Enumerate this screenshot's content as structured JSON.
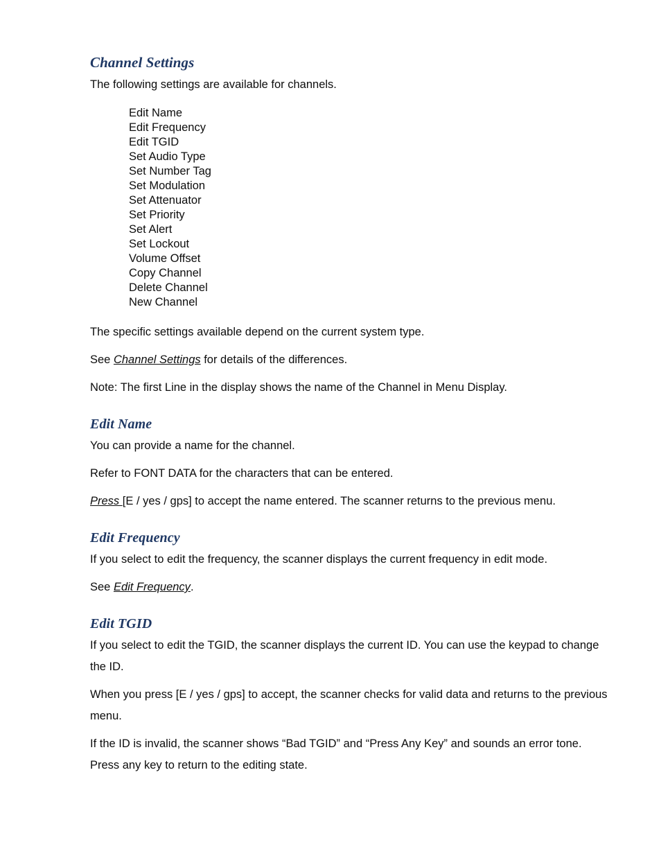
{
  "document": {
    "sections": {
      "channel_settings": {
        "heading": "Channel Settings",
        "intro": "The following settings are available for channels.",
        "settings_list": [
          "Edit Name",
          "Edit Frequency",
          "Edit TGID",
          "Set Audio Type",
          "Set Number Tag",
          "Set Modulation",
          "Set Attenuator",
          "Set Priority",
          "Set Alert",
          "Set Lockout",
          "Volume Offset",
          "Copy Channel",
          "Delete Channel",
          "New Channel"
        ],
        "depends_note": "The specific settings available depend on the current system type.",
        "see_prefix": "See ",
        "see_link": "Channel Settings",
        "see_suffix": " for details of the differences.",
        "display_note": "Note: The first Line in the display shows the name of the Channel in Menu Display."
      },
      "edit_name": {
        "heading": "Edit Name",
        "para1": "You can provide a name for the channel.",
        "para2": "Refer to FONT DATA for the characters that can be entered.",
        "press_link": "Press ",
        "press_rest": "[E / yes / gps] to accept the name entered. The scanner returns to the previous menu."
      },
      "edit_frequency": {
        "heading": "Edit Frequency",
        "para1": "If you select to edit the frequency, the scanner displays the current frequency in edit mode.",
        "see_prefix": "See ",
        "see_link": "Edit Frequency",
        "see_suffix": "."
      },
      "edit_tgid": {
        "heading": "Edit TGID",
        "para1": "If you select to edit the TGID, the scanner displays the current ID. You can use the keypad to change the ID.",
        "para2": "When you press [E / yes / gps] to accept, the scanner checks for valid data and returns to the previous menu.",
        "para3": "If the ID is invalid, the scanner shows “Bad TGID” and “Press Any Key” and sounds an error tone. Press any key to return to the editing state."
      }
    },
    "colors": {
      "heading": "#1F3864",
      "body": "#0D0D0D",
      "background": "#FFFFFF"
    }
  }
}
